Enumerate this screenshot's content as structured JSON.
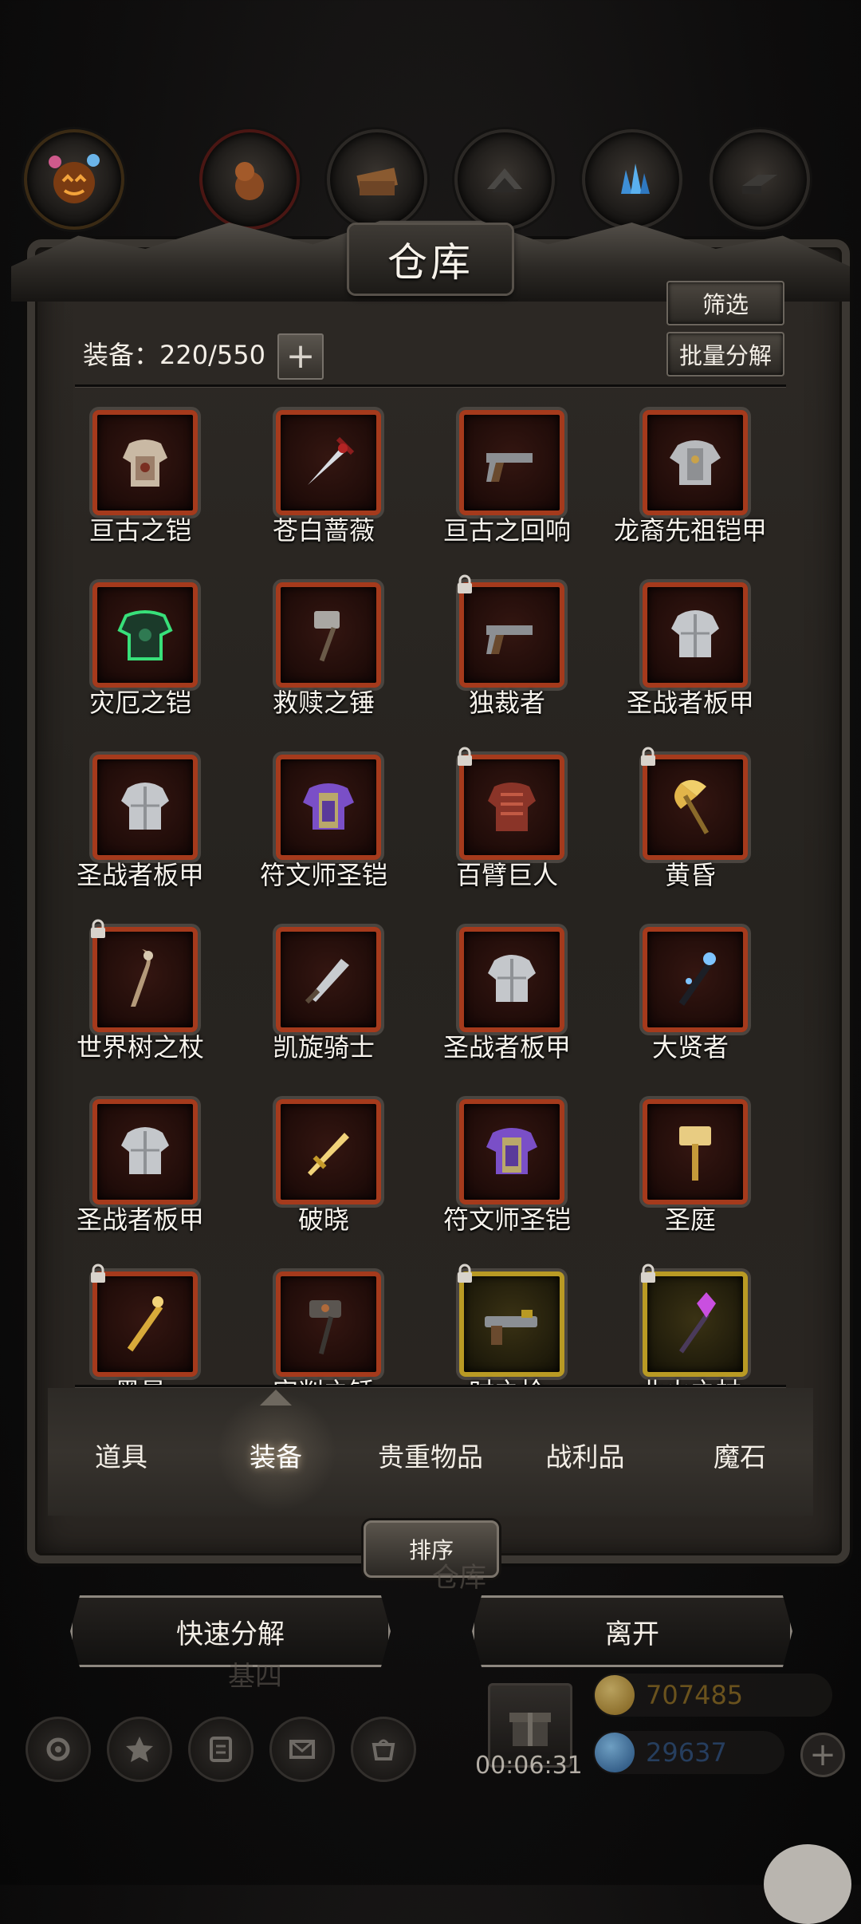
{
  "warehouse": {
    "title": "仓库",
    "filter_label": "筛选",
    "bulk_decompose_label": "批量分解",
    "capacity_label": "装备：220/550",
    "plus_label": "+"
  },
  "items": [
    {
      "name": "亘古之铠",
      "icon": "ancient-armor",
      "locked": false,
      "frame": "red"
    },
    {
      "name": "苍白蔷薇",
      "icon": "sword",
      "locked": false,
      "frame": "red"
    },
    {
      "name": "亘古之回响",
      "icon": "pistol",
      "locked": false,
      "frame": "red"
    },
    {
      "name": "龙裔先祖铠甲",
      "icon": "plate-armor",
      "locked": false,
      "frame": "red"
    },
    {
      "name": "灾厄之铠",
      "icon": "green-armor",
      "locked": false,
      "frame": "red"
    },
    {
      "name": "救赎之锤",
      "icon": "hammer",
      "locked": false,
      "frame": "red"
    },
    {
      "name": "独裁者",
      "icon": "pistol",
      "locked": true,
      "frame": "red"
    },
    {
      "name": "圣战者板甲",
      "icon": "steel-armor",
      "locked": false,
      "frame": "red"
    },
    {
      "name": "圣战者板甲",
      "icon": "steel-armor",
      "locked": false,
      "frame": "red"
    },
    {
      "name": "符文师圣铠",
      "icon": "purple-armor",
      "locked": false,
      "frame": "red"
    },
    {
      "name": "百臂巨人",
      "icon": "red-armor",
      "locked": true,
      "frame": "red"
    },
    {
      "name": "黄昏",
      "icon": "golden-axe",
      "locked": true,
      "frame": "red"
    },
    {
      "name": "世界树之杖",
      "icon": "wooden-staff",
      "locked": true,
      "frame": "red"
    },
    {
      "name": "凯旋骑士",
      "icon": "greatsword",
      "locked": false,
      "frame": "red"
    },
    {
      "name": "圣战者板甲",
      "icon": "steel-armor",
      "locked": false,
      "frame": "red"
    },
    {
      "name": "大贤者",
      "icon": "scepter",
      "locked": false,
      "frame": "red"
    },
    {
      "name": "圣战者板甲",
      "icon": "steel-armor",
      "locked": false,
      "frame": "red"
    },
    {
      "name": "破晓",
      "icon": "golden-sword",
      "locked": false,
      "frame": "red"
    },
    {
      "name": "符文师圣铠",
      "icon": "purple-armor",
      "locked": false,
      "frame": "red"
    },
    {
      "name": "圣庭",
      "icon": "golden-hammer",
      "locked": false,
      "frame": "red"
    },
    {
      "name": "黑星",
      "icon": "golden-staff",
      "locked": true,
      "frame": "red"
    },
    {
      "name": "审判之锤",
      "icon": "dark-hammer",
      "locked": false,
      "frame": "red"
    },
    {
      "name": "时之枪",
      "icon": "gun",
      "locked": true,
      "frame": "gold"
    },
    {
      "name": "业火之杖",
      "icon": "crystal-staff",
      "locked": true,
      "frame": "gold"
    }
  ],
  "tabs": [
    {
      "label": "道具"
    },
    {
      "label": "装备"
    },
    {
      "label": "贵重物品"
    },
    {
      "label": "战利品"
    },
    {
      "label": "魔石"
    }
  ],
  "sort_label": "排序",
  "quick_decompose_label": "快速分解",
  "leave_label": "离开",
  "background_text": {
    "warehouse": "仓库",
    "misc": "基四"
  },
  "hud": {
    "timer": "00:06:31",
    "gold_amount": "707485",
    "gem_amount": "29637",
    "plus_label": "+"
  },
  "colors": {
    "rare_frame": "#a53a1c",
    "legendary_frame": "#b99a24",
    "gold_text": "#8a6a24",
    "gem_text": "#2f4f7a"
  }
}
